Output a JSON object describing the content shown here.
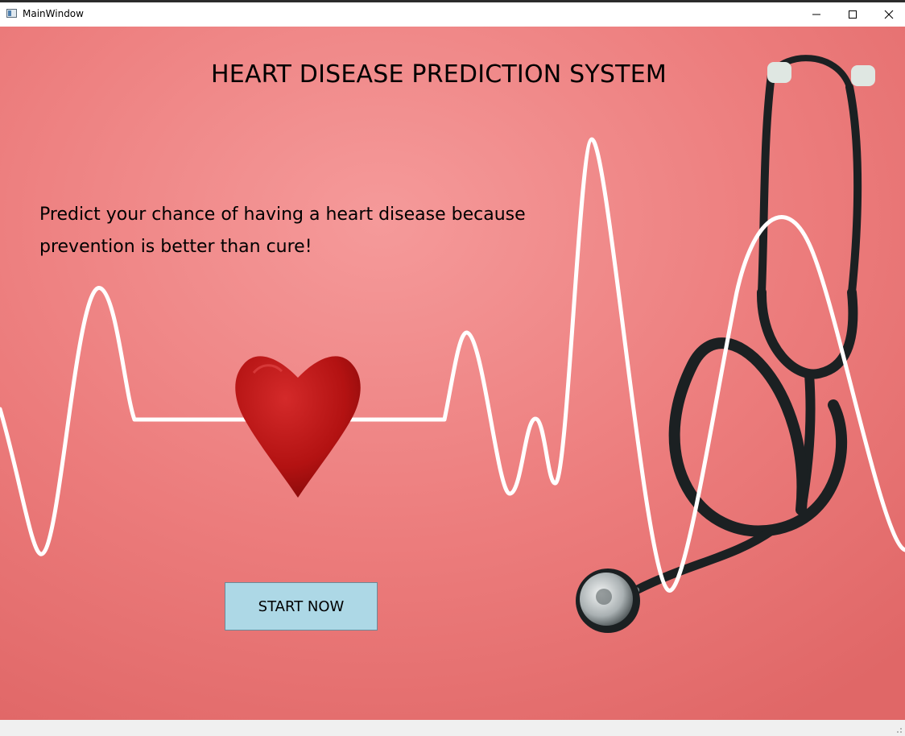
{
  "window": {
    "title": "MainWindow",
    "controls": {
      "minimize_icon": "minimize-icon",
      "maximize_icon": "maximize-icon",
      "close_icon": "close-icon"
    }
  },
  "main": {
    "heading": "HEART DISEASE PREDICTION SYSTEM",
    "tagline": "Predict your chance of having a heart disease because prevention is better than cure!",
    "start_button_label": "START NOW"
  },
  "colors": {
    "background": "#ea7474",
    "button": "#add8e6",
    "heart": "#b50f12",
    "ecg_line": "#ffffff",
    "stethoscope": "#1e2426"
  }
}
